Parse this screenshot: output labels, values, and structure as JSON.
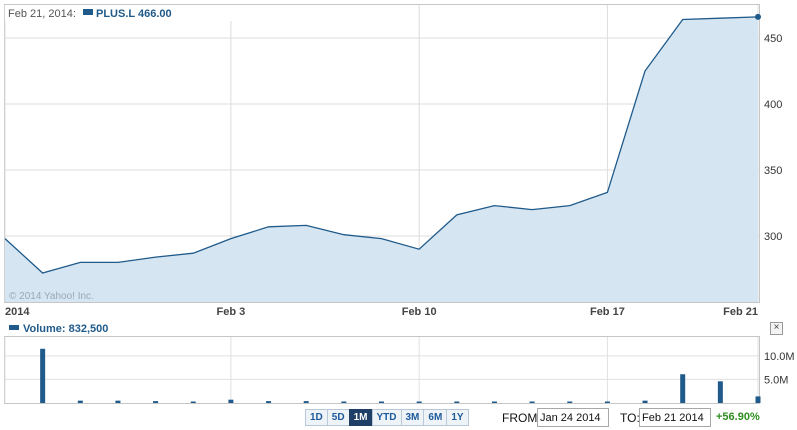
{
  "header": {
    "date_label": "Feb 21, 2014:",
    "series_label": "PLUS.L 466.00",
    "series_color": "#1f5a8a"
  },
  "volume_header": {
    "label": "Volume: 832,500"
  },
  "watermark": "© 2014 Yahoo! Inc.",
  "range_buttons": [
    {
      "label": "1D",
      "active": false
    },
    {
      "label": "5D",
      "active": false
    },
    {
      "label": "1M",
      "active": true
    },
    {
      "label": "YTD",
      "active": false
    },
    {
      "label": "3M",
      "active": false
    },
    {
      "label": "6M",
      "active": false
    },
    {
      "label": "1Y",
      "active": false
    }
  ],
  "from": {
    "label": "FROM:",
    "value": "Jan 24 2014"
  },
  "to": {
    "label": "TO:",
    "value": "Feb 21 2014"
  },
  "change": {
    "value": "+56.90%",
    "color": "#2d8f1e"
  },
  "close_icon": "close-icon",
  "chart_data": {
    "type": "area",
    "line_color": "#1f5a8a",
    "fill_color": "#d5e5f1",
    "price": {
      "x": [
        "Jan 24",
        "Jan 27",
        "Jan 28",
        "Jan 29",
        "Jan 30",
        "Jan 31",
        "Feb 3",
        "Feb 4",
        "Feb 5",
        "Feb 6",
        "Feb 7",
        "Feb 10",
        "Feb 11",
        "Feb 12",
        "Feb 13",
        "Feb 14",
        "Feb 17",
        "Feb 18",
        "Feb 19",
        "Feb 20",
        "Feb 21"
      ],
      "values": [
        298,
        272,
        280,
        280,
        284,
        287,
        298,
        307,
        308,
        301,
        298,
        290,
        316,
        323,
        320,
        323,
        333,
        425,
        464,
        465,
        466
      ],
      "ylim": [
        250,
        475
      ],
      "y_ticks": [
        "300",
        "350",
        "400",
        "450"
      ],
      "x_labels": [
        {
          "at": "Jan 24",
          "text": "2014"
        },
        {
          "at": "Feb 3",
          "text": "Feb 3"
        },
        {
          "at": "Feb 10",
          "text": "Feb 10"
        },
        {
          "at": "Feb 17",
          "text": "Feb 17"
        },
        {
          "at": "Feb 21",
          "text": "Feb 21"
        }
      ]
    },
    "volume": {
      "x": [
        "Jan 27",
        "Jan 28",
        "Jan 29",
        "Jan 30",
        "Jan 31",
        "Feb 3",
        "Feb 4",
        "Feb 5",
        "Feb 6",
        "Feb 7",
        "Feb 10",
        "Feb 11",
        "Feb 12",
        "Feb 13",
        "Feb 14",
        "Feb 17",
        "Feb 18",
        "Feb 19",
        "Feb 20",
        "Feb 21"
      ],
      "values": [
        11.5,
        0.5,
        0.5,
        0.4,
        0.3,
        0.7,
        0.4,
        0.4,
        0.2,
        0.2,
        0.2,
        0.2,
        0.2,
        0.2,
        0.2,
        0.2,
        0.5,
        6.1,
        4.6,
        1.4
      ],
      "units": "M",
      "ylim": [
        0,
        14
      ],
      "y_ticks": [
        {
          "value": 5,
          "text": "5.0M"
        },
        {
          "value": 10,
          "text": "10.0M"
        }
      ]
    }
  }
}
